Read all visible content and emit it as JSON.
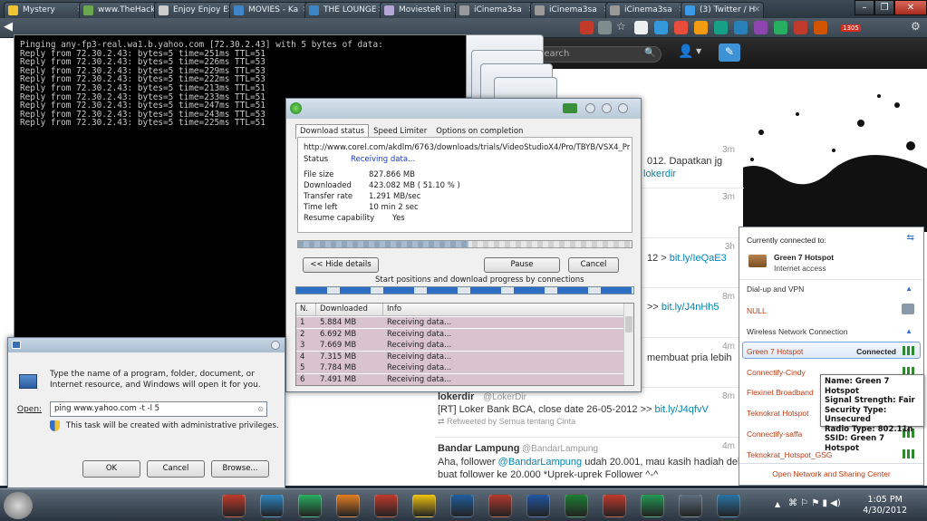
{
  "browser": {
    "tabs": [
      {
        "label": "Mystery",
        "color": "#f1c232"
      },
      {
        "label": "www.TheHack",
        "color": "#6aa84f"
      },
      {
        "label": "Enjoy Enjoy E",
        "color": "#cccccc"
      },
      {
        "label": "MOVIES - Ka",
        "color": "#3d85c6"
      },
      {
        "label": "THE LOUNGE",
        "color": "#3d85c6"
      },
      {
        "label": "MoviesteR in",
        "color": "#b4a7d6"
      },
      {
        "label": "iCinema3sa",
        "color": "#999999"
      },
      {
        "label": "iCinema3sa",
        "color": "#999999"
      },
      {
        "label": "iCinema3sa",
        "color": "#999999"
      },
      {
        "label": "(3) Twitter / H",
        "color": "#3d9ae8"
      }
    ],
    "window_buttons": [
      "–",
      "❐",
      "✕"
    ],
    "badge": "1305"
  },
  "twitter": {
    "search_placeholder": "Search",
    "tweets": [
      {
        "time": "3m",
        "text": "012. Dapatkan jg",
        "link": "lokerdir"
      },
      {
        "time": "3m",
        "text": "",
        "link": ""
      },
      {
        "time": "3h",
        "text": "12 > ",
        "link": "bit.ly/IeQaE3"
      },
      {
        "time": "8m",
        "text": ">> ",
        "link": "bit.ly/J4nHh5"
      },
      {
        "time": "4m",
        "text": "membuat pria lebih",
        "link": ""
      },
      {
        "time": "8m",
        "name": "lokerdir",
        "handle": "@LokerDir",
        "text": "[RT] Loker Bank BCA, close date 26-05-2012 >> ",
        "link": "bit.ly/J4qfvV",
        "retweet": "Retweeted by Semua tentang Cinta"
      },
      {
        "time": "4m",
        "name": "Bandar Lampung",
        "handle": "@BandarLampung",
        "text1": "Aha, follower ",
        "mention": "@BandarLampung",
        "text2": " udah 20.001, mau kasih hadiah deh",
        "text3": "buat follower ke 20.000 *Uprek-uprek Follower ^-^"
      }
    ]
  },
  "cmd": {
    "lines": [
      "Pinging any-fp3-real.wa1.b.yahoo.com [72.30.2.43] with 5 bytes of data:",
      "Reply from 72.30.2.43: bytes=5 time=251ms TTL=51",
      "Reply from 72.30.2.43: bytes=5 time=226ms TTL=53",
      "Reply from 72.30.2.43: bytes=5 time=229ms TTL=53",
      "Reply from 72.30.2.43: bytes=5 time=222ms TTL=53",
      "Reply from 72.30.2.43: bytes=5 time=213ms TTL=51",
      "Reply from 72.30.2.43: bytes=5 time=233ms TTL=51",
      "Reply from 72.30.2.43: bytes=5 time=247ms TTL=51",
      "Reply from 72.30.2.43: bytes=5 time=243ms TTL=53",
      "Reply from 72.30.2.43: bytes=5 time=225ms TTL=51"
    ]
  },
  "idm": {
    "tabs": [
      "Download status",
      "Speed Limiter",
      "Options on completion"
    ],
    "url": "http://www.corel.com/akdlm/6763/downloads/trials/VideoStudioX4/Pro/TBYB/VSX4_Pro_TBYB.e",
    "status_label": "Status",
    "status_value": "Receiving data...",
    "file_size_label": "File size",
    "file_size": "827.866  MB",
    "downloaded_label": "Downloaded",
    "downloaded": "423.082  MB  ( 51.10 % )",
    "rate_label": "Transfer rate",
    "rate": "1.291  MB/sec",
    "time_left_label": "Time left",
    "time_left": "10 min 2 sec",
    "resume_label": "Resume capability",
    "resume": "Yes",
    "progress": 0.511,
    "hide_details": "<< Hide details",
    "pause": "Pause",
    "cancel": "Cancel",
    "connections_caption": "Start positions and download progress by connections",
    "columns": [
      "N.",
      "Downloaded",
      "Info"
    ],
    "rows": [
      {
        "n": "1",
        "size": "5.884 MB",
        "info": "Receiving data..."
      },
      {
        "n": "2",
        "size": "6.692 MB",
        "info": "Receiving data..."
      },
      {
        "n": "3",
        "size": "7.669 MB",
        "info": "Receiving data..."
      },
      {
        "n": "4",
        "size": "7.315 MB",
        "info": "Receiving data..."
      },
      {
        "n": "5",
        "size": "7.784 MB",
        "info": "Receiving data..."
      },
      {
        "n": "6",
        "size": "7.491 MB",
        "info": "Receiving data..."
      }
    ]
  },
  "run": {
    "description": "Type the name of a program, folder, document, or Internet resource, and Windows will open it for you.",
    "open_label": "Open:",
    "open_value": "ping www.yahoo.com -t -l 5",
    "admin_note": "This task will be created with administrative privileges.",
    "ok": "OK",
    "cancel": "Cancel",
    "browse": "Browse..."
  },
  "network": {
    "connected_to": "Currently connected to:",
    "current_name": "Green 7 Hotspot",
    "current_status": "Internet access",
    "dialup": "Dial-up and VPN",
    "null": "NULL",
    "wireless": "Wireless Network Connection",
    "items": [
      {
        "name": "Green 7 Hotspot",
        "status": "Connected"
      },
      {
        "name": "Connectify-Cindy",
        "status": ""
      },
      {
        "name": "Flexinet Broadband",
        "status": ""
      },
      {
        "name": "Teknokrat Hotspot",
        "status": ""
      },
      {
        "name": "Connectify-saffa",
        "status": ""
      },
      {
        "name": "Teknokrat_Hotspot_GSG",
        "status": ""
      }
    ],
    "footer": "Open Network and Sharing Center",
    "tooltip": [
      "Name: Green 7 Hotspot",
      "Signal Strength: Fair",
      "Security Type: Unsecured",
      "Radio Type: 802.11n",
      "SSID: Green 7 Hotspot"
    ]
  },
  "taskbar": {
    "time": "1:05 PM",
    "date": "4/30/2012",
    "apps": [
      {
        "name": "app-icon",
        "color": "#c0392b"
      },
      {
        "name": "media-player-icon",
        "color": "#2e86c1"
      },
      {
        "name": "chrome-icon",
        "color": "#27ae60"
      },
      {
        "name": "firefox-icon",
        "color": "#e67e22"
      },
      {
        "name": "ccleaner-icon",
        "color": "#c0392b"
      },
      {
        "name": "folder-icon",
        "color": "#f1c40f"
      },
      {
        "name": "photoshop-icon",
        "color": "#1f5e9e"
      },
      {
        "name": "flash-icon",
        "color": "#b03a2e"
      },
      {
        "name": "word-icon",
        "color": "#2155a4"
      },
      {
        "name": "excel-icon",
        "color": "#1e7e34"
      },
      {
        "name": "powerpoint-icon",
        "color": "#c0392b"
      },
      {
        "name": "idm-icon",
        "color": "#229954"
      },
      {
        "name": "window-icon",
        "color": "#5d6d7e"
      },
      {
        "name": "run-icon",
        "color": "#2874a6"
      }
    ]
  }
}
